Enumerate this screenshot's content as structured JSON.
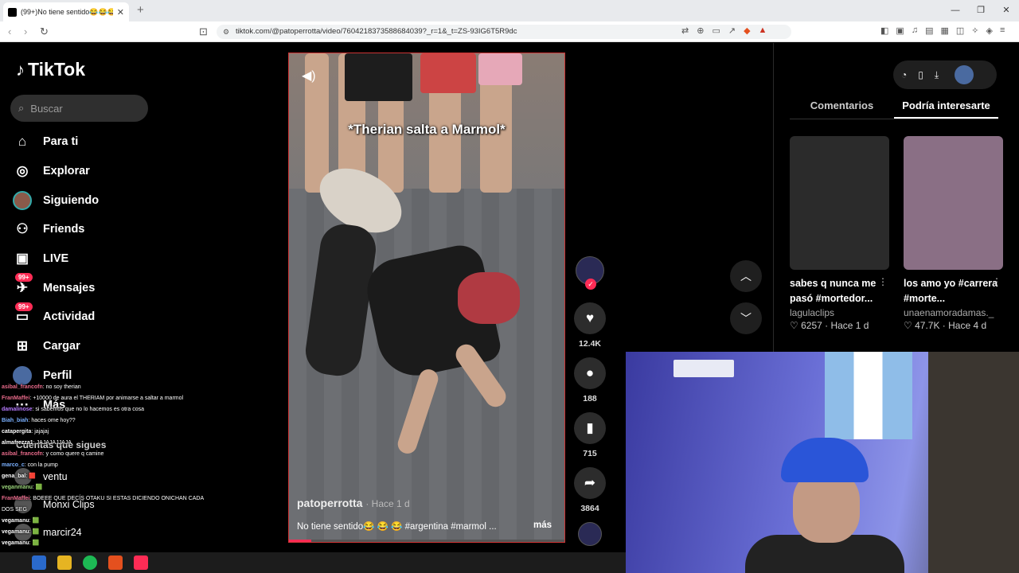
{
  "browser": {
    "tab_title": "(99+)No tiene sentido😂😂😂",
    "url": "tiktok.com/@patoperrotta/video/7604218373588684039?_r=1&_t=ZS-93IG6T5R9dc"
  },
  "sidebar": {
    "logo": "TikTok",
    "search_placeholder": "Buscar",
    "items": [
      {
        "label": "Para ti",
        "icon": "home-icon"
      },
      {
        "label": "Explorar",
        "icon": "compass-icon"
      },
      {
        "label": "Siguiendo",
        "icon": "avatar-icon"
      },
      {
        "label": "Friends",
        "icon": "friends-icon"
      },
      {
        "label": "LIVE",
        "icon": "live-icon"
      },
      {
        "label": "Mensajes",
        "icon": "message-icon",
        "badge": "99+"
      },
      {
        "label": "Actividad",
        "icon": "inbox-icon",
        "badge": "99+"
      },
      {
        "label": "Cargar",
        "icon": "upload-icon"
      },
      {
        "label": "Perfil",
        "icon": "profile-icon"
      },
      {
        "label": "Más",
        "icon": "more-icon"
      }
    ],
    "following_title": "Cuentas que sigues",
    "following": [
      "ventu",
      "Monxi Clips",
      "marcir24"
    ]
  },
  "chat": [
    {
      "user": "asibal_francofn",
      "msg": ": no soy therian",
      "color": "#e86a8a"
    },
    {
      "user": "FranMaffei",
      "msg": ": +10000 de aura el THERIAM por animarse a saltar a marmol",
      "color": "#e86a8a"
    },
    {
      "user": "damalinose",
      "msg": ": si sabemos que no lo hacemos es otra cosa",
      "color": "#b67aff"
    },
    {
      "user": "Biah_biah",
      "msg": ": haces ome hoy??",
      "color": "#7ab0ff"
    },
    {
      "user": "catapergita",
      "msg": ": jajajaj",
      "color": "#ffffff"
    },
    {
      "user": "almafrezza1",
      "msg": ": JAJAJAJJAJA",
      "color": "#ffffff"
    },
    {
      "user": "asibal_francofn",
      "msg": ": y como quere q camine",
      "color": "#e86a8a"
    },
    {
      "user": "marco_c",
      "msg": ": con la pump",
      "color": "#7ab0ff"
    },
    {
      "user": "gena_bal",
      "msg": ": 🟥",
      "color": "#ffffff"
    },
    {
      "user": "veganmanu",
      "msg": ": 🟩",
      "color": "#9ad27a"
    },
    {
      "user": "FranMaffei",
      "msg": ": BOEEE QUE DECÍS OTAKU SI ESTAS DICIENDO ONICHAN CADA DOS SEG",
      "color": "#e86a8a"
    },
    {
      "user": "vegamanu",
      "msg": ": 🟩",
      "color": "#ffffff"
    },
    {
      "user": "vegamanu",
      "msg": ": 🟩",
      "color": "#ffffff"
    },
    {
      "user": "vegamanu",
      "msg": ": 🟩",
      "color": "#ffffff"
    }
  ],
  "video": {
    "caption_overlay": "*Therian salta a Marmol*",
    "username": "patoperrotta",
    "time": "· Hace 1 d",
    "description": "No tiene sentido😂 😂 😂  #argentina #marmol ...",
    "more": "más",
    "progress": 0.08
  },
  "actions": {
    "likes": "12.4K",
    "comments": "188",
    "saves": "715",
    "shares": "3864"
  },
  "right_panel": {
    "tabs": [
      "Comentarios",
      "Podría interesarte"
    ],
    "active_tab": 1,
    "recs": [
      {
        "title": "sabes q nunca me pasó #mortedor...",
        "author": "lagulaclips",
        "meta": "♡ 6257 · Hace 1 d",
        "color": "#2b2b2b"
      },
      {
        "title": "los amo yo #carrera #morte...",
        "author": "unaenamoradamas._",
        "meta": "♡ 47.7K · Hace 4 d",
        "color": "#8a6f85"
      }
    ]
  },
  "colors": {
    "accent": "#fe2c55",
    "background": "#000000"
  }
}
